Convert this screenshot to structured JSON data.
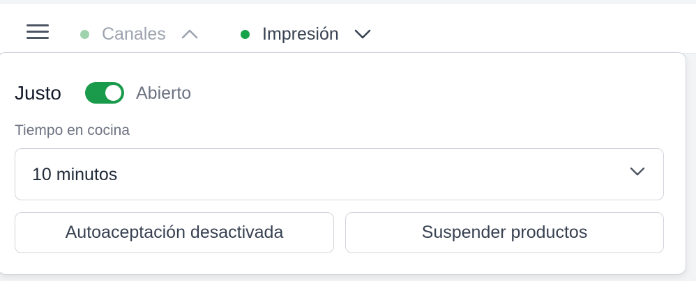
{
  "header": {
    "channels": [
      {
        "label": "Canales",
        "dot_color": "#9fd3ae",
        "chevron": "chevron-up-icon"
      },
      {
        "label": "Impresión",
        "dot_color": "#16a34a",
        "chevron": "chevron-down-icon"
      }
    ],
    "menu_icon": "hamburger-menu-icon"
  },
  "panel": {
    "store_name": "Justo",
    "toggle_on": true,
    "toggle_color": "#1a9b4b",
    "status_label": "Abierto",
    "kitchen_time": {
      "label": "Tiempo en cocina",
      "value": "10 minutos",
      "chevron": "chevron-down-icon"
    },
    "buttons": {
      "auto_accept": "Autoaceptación desactivada",
      "suspend": "Suspender productos"
    }
  }
}
